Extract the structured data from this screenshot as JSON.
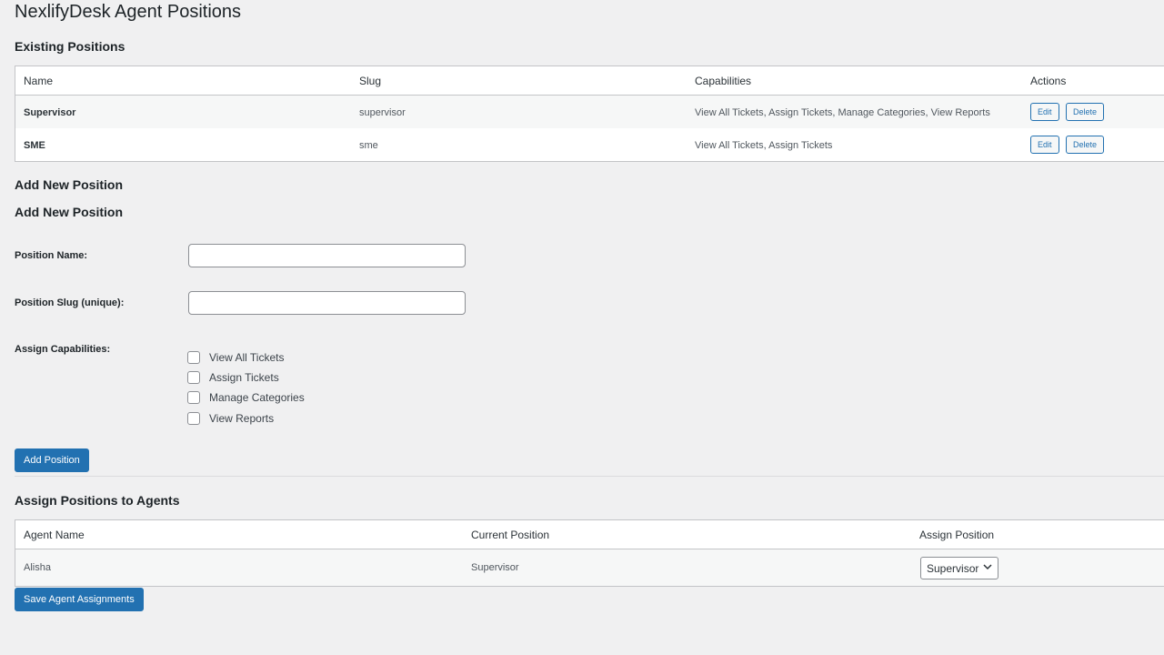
{
  "page": {
    "title": "NexlifyDesk Agent Positions"
  },
  "existing": {
    "heading": "Existing Positions",
    "columns": [
      "Name",
      "Slug",
      "Capabilities",
      "Actions"
    ],
    "rows": [
      {
        "name": "Supervisor",
        "slug": "supervisor",
        "capabilities": "View All Tickets, Assign Tickets, Manage Categories, View Reports",
        "edit": "Edit",
        "delete": "Delete"
      },
      {
        "name": "SME",
        "slug": "sme",
        "capabilities": "View All Tickets, Assign Tickets",
        "edit": "Edit",
        "delete": "Delete"
      }
    ]
  },
  "add_form": {
    "heading": "Add New Position",
    "subheading": "Add New Position",
    "name_label": "Position Name:",
    "name_value": "",
    "slug_label": "Position Slug (unique):",
    "slug_value": "",
    "capabilities_label": "Assign Capabilities:",
    "capabilities": [
      {
        "label": "View All Tickets",
        "checked": false
      },
      {
        "label": "Assign Tickets",
        "checked": false
      },
      {
        "label": "Manage Categories",
        "checked": false
      },
      {
        "label": "View Reports",
        "checked": false
      }
    ],
    "submit_label": "Add Position"
  },
  "assign": {
    "heading": "Assign Positions to Agents",
    "columns": [
      "Agent Name",
      "Current Position",
      "Assign Position"
    ],
    "rows": [
      {
        "agent": "Alisha",
        "current": "Supervisor",
        "selected": "Supervisor"
      }
    ],
    "save_label": "Save Agent Assignments"
  },
  "icons": {
    "dropdown": "chevron-down-icon"
  },
  "colors": {
    "primary": "#2271b1",
    "background": "#f0f0f1"
  }
}
